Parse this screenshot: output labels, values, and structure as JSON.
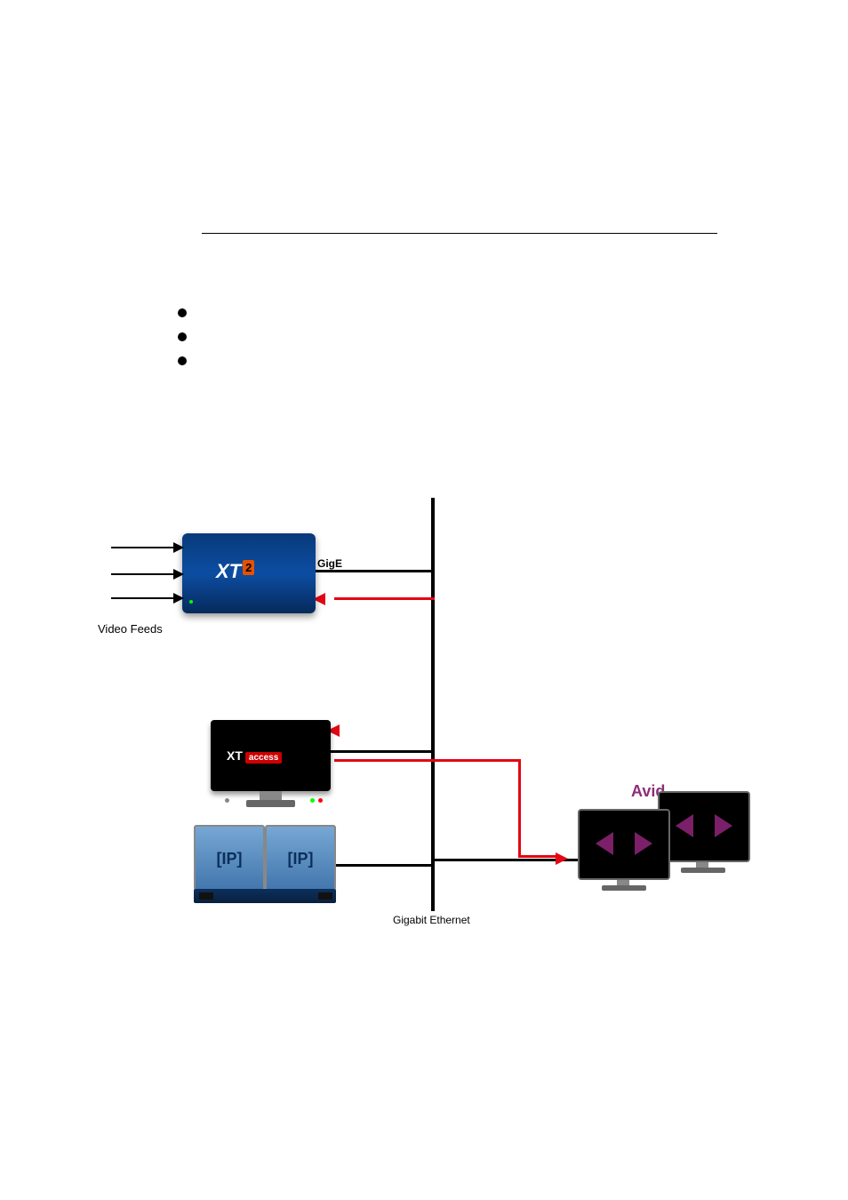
{
  "diagram": {
    "feeds_label": "Video Feeds",
    "gige_label": "GigE",
    "gigabit_label": "Gigabit Ethernet",
    "xt2": {
      "logo": "XT",
      "suffix": "2"
    },
    "xtaccess": {
      "logo_main": "XT",
      "logo_badge": "access"
    },
    "ip": {
      "label": "[IP]"
    },
    "avid": {
      "label": "Avid"
    },
    "components": [
      {
        "name": "xt2-server",
        "type": "video-server",
        "io": "records Video Feeds, connects via GigE"
      },
      {
        "name": "xtaccess-workstation",
        "type": "gateway",
        "connects": [
          "gigabit-backbone"
        ]
      },
      {
        "name": "ip-director",
        "type": "controller-pair",
        "connects": [
          "gigabit-backbone"
        ]
      },
      {
        "name": "avid-workstations",
        "type": "edit-client",
        "connects": [
          "gigabit-backbone"
        ]
      }
    ],
    "links": {
      "black": "Gigabit Ethernet data connections",
      "red": "control / transfer path returning to XT2 via XTAccess and out to Avid"
    }
  }
}
